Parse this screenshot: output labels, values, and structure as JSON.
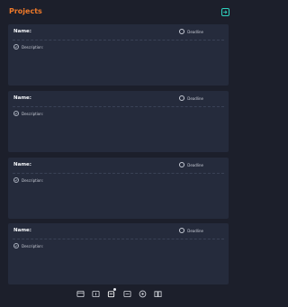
{
  "header": {
    "title": "Projects",
    "exit_icon": "exit-icon"
  },
  "colors": {
    "accent": "#f07a2a",
    "teal": "#2fd3c0",
    "card_bg": "#252b3c",
    "page_bg": "#1c1f2b"
  },
  "cards": [
    {
      "name_label": "Name:",
      "deadline_label": "Deadline",
      "description_label": "Description:"
    },
    {
      "name_label": "Name:",
      "deadline_label": "Deadline",
      "description_label": "Description:"
    },
    {
      "name_label": "Name:",
      "deadline_label": "Deadline",
      "description_label": "Description:"
    },
    {
      "name_label": "Name:",
      "deadline_label": "Deadline",
      "description_label": "Description:"
    }
  ],
  "bottom_nav": [
    {
      "icon": "calendar-grid-icon"
    },
    {
      "icon": "day-calendar-icon"
    },
    {
      "icon": "tasks-icon"
    },
    {
      "icon": "inbox-icon"
    },
    {
      "icon": "add-circle-icon"
    },
    {
      "icon": "book-icon"
    }
  ]
}
